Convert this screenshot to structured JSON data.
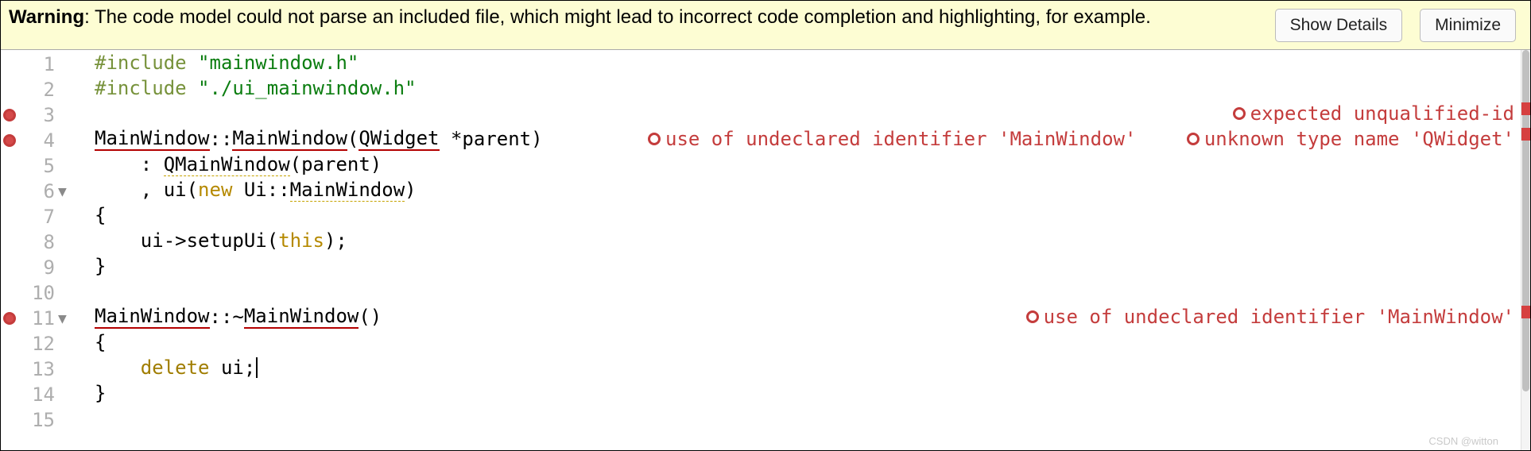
{
  "warning": {
    "label": "Warning",
    "text": ": The code model could not parse an included file, which might lead to incorrect code completion and highlighting, for example.",
    "show_details": "Show Details",
    "minimize": "Minimize"
  },
  "editor": {
    "lines": {
      "1": {
        "indent": "",
        "tokens": [
          {
            "t": "#include ",
            "c": "tok-pp"
          },
          {
            "t": "\"mainwindow.h\"",
            "c": "tok-str"
          }
        ]
      },
      "2": {
        "indent": "",
        "tokens": [
          {
            "t": "#include ",
            "c": "tok-pp"
          },
          {
            "t": "\"./ui_mainwindow.h\"",
            "c": "tok-str"
          }
        ]
      },
      "3": {
        "indent": "",
        "tokens": [],
        "error_bg": true,
        "gutter_err": true,
        "hints": [
          {
            "t": "expected unqualified-id"
          }
        ]
      },
      "4": {
        "indent": "",
        "error_bg": true,
        "gutter_err": true,
        "tokens": [
          {
            "t": "MainWindow",
            "u": "red"
          },
          {
            "t": "::"
          },
          {
            "t": "MainWindow",
            "u": "red"
          },
          {
            "t": "("
          },
          {
            "t": "QWidget",
            "u": "red"
          },
          {
            "t": " *parent)"
          }
        ],
        "hints": [
          {
            "t": "use of undeclared identifier 'MainWindow'"
          },
          {
            "t": "unknown type name 'QWidget'"
          }
        ],
        "hint_wide": true
      },
      "5": {
        "indent": "    ",
        "tokens": [
          {
            "t": ": "
          },
          {
            "t": "QMainWindow",
            "u": "soft"
          },
          {
            "t": "(parent)"
          }
        ]
      },
      "6": {
        "indent": "    ",
        "fold": true,
        "tokens": [
          {
            "t": ", ui("
          },
          {
            "t": "new",
            "c": "tok-kw"
          },
          {
            "t": " Ui::"
          },
          {
            "t": "MainWindow",
            "u": "soft"
          },
          {
            "t": ")"
          }
        ]
      },
      "7": {
        "indent": "",
        "tokens": [
          {
            "t": "{"
          }
        ]
      },
      "8": {
        "indent": "    ",
        "tokens": [
          {
            "t": "ui->setupUi("
          },
          {
            "t": "this",
            "c": "tok-kw"
          },
          {
            "t": ");"
          }
        ]
      },
      "9": {
        "indent": "",
        "tokens": [
          {
            "t": "}"
          }
        ]
      },
      "10": {
        "indent": "",
        "tokens": []
      },
      "11": {
        "indent": "",
        "error_bg": true,
        "gutter_err": true,
        "fold": true,
        "tokens": [
          {
            "t": "MainWindow",
            "u": "red"
          },
          {
            "t": "::~"
          },
          {
            "t": "MainWindow",
            "u": "red"
          },
          {
            "t": "()"
          }
        ],
        "hints": [
          {
            "t": "use of undeclared identifier 'MainWindow'"
          }
        ]
      },
      "12": {
        "indent": "",
        "tokens": [
          {
            "t": "{"
          }
        ]
      },
      "13": {
        "indent": "    ",
        "tokens": [
          {
            "t": "delete",
            "c": "tok-kw2"
          },
          {
            "t": " ui;"
          }
        ],
        "cursor": true
      },
      "14": {
        "indent": "",
        "tokens": [
          {
            "t": "}"
          }
        ]
      },
      "15": {
        "indent": "",
        "tokens": []
      }
    },
    "count": 15
  },
  "watermark": "CSDN @witton"
}
